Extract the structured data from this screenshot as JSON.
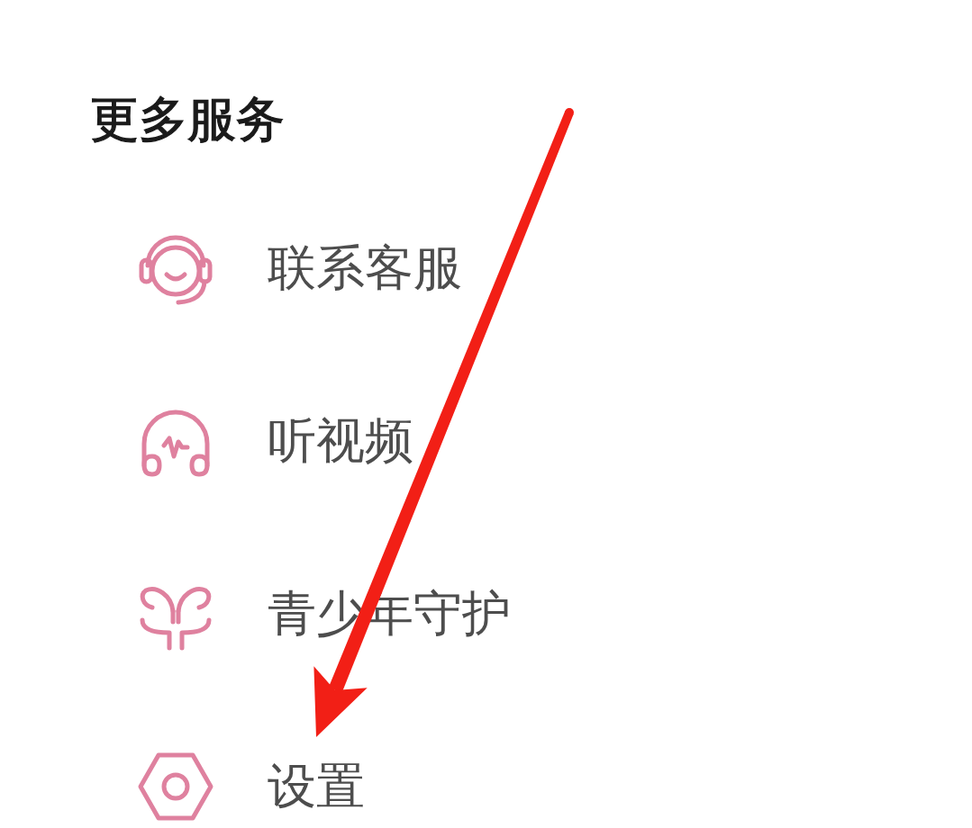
{
  "section": {
    "title": "更多服务",
    "items": [
      {
        "kind": "service",
        "label": "联系客服"
      },
      {
        "kind": "listen",
        "label": "听视频"
      },
      {
        "kind": "guard",
        "label": "青少年守护"
      },
      {
        "kind": "settings",
        "label": "设置"
      }
    ]
  },
  "annotation": {
    "kind": "arrow"
  }
}
